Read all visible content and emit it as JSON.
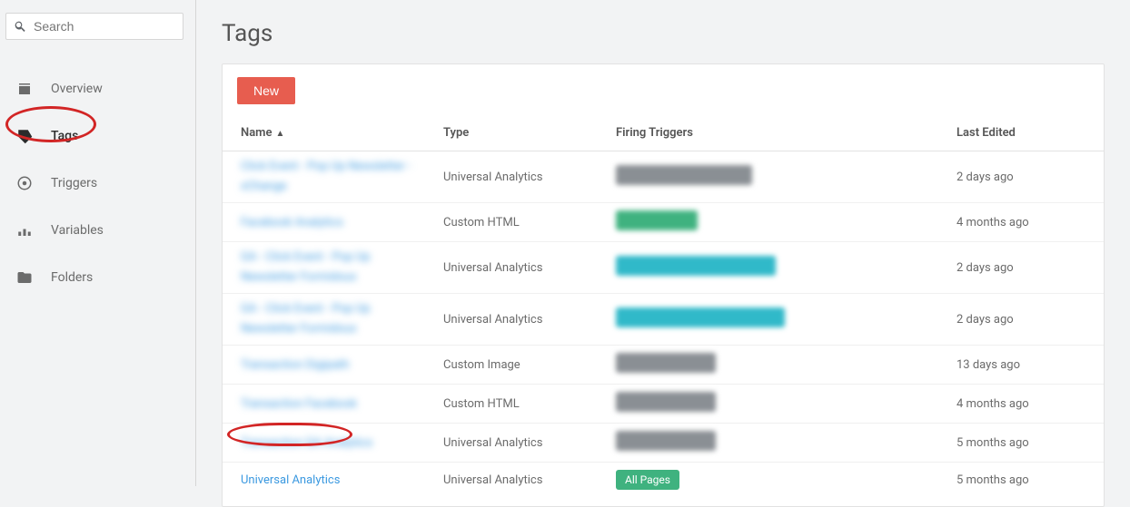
{
  "search": {
    "placeholder": "Search"
  },
  "sidebar": {
    "items": [
      {
        "label": "Overview",
        "icon": "overview"
      },
      {
        "label": "Tags",
        "icon": "tag"
      },
      {
        "label": "Triggers",
        "icon": "trigger"
      },
      {
        "label": "Variables",
        "icon": "variable"
      },
      {
        "label": "Folders",
        "icon": "folder"
      }
    ]
  },
  "page": {
    "title": "Tags",
    "new_label": "New"
  },
  "table": {
    "headers": {
      "name": "Name",
      "type": "Type",
      "triggers": "Firing Triggers",
      "edited": "Last Edited"
    },
    "rows": [
      {
        "name_blur": "Click Event - Pop Up Newsletter - xChange",
        "type": "Universal Analytics",
        "trigger_style": "gray",
        "trigger_w": 150,
        "edited": "2 days ago",
        "tall": true
      },
      {
        "name_blur": "Facebook Analytics",
        "type": "Custom HTML",
        "trigger_style": "green",
        "trigger_w": 90,
        "edited": "4 months ago",
        "tall": false
      },
      {
        "name_blur": "GA - Click Event - Pop Up Newsletter Formidoux",
        "type": "Universal Analytics",
        "trigger_style": "teal",
        "trigger_w": 176,
        "edited": "2 days ago",
        "tall": true
      },
      {
        "name_blur": "GA - Click Event - Pop Up Newsletter Formidoux",
        "type": "Universal Analytics",
        "trigger_style": "teal",
        "trigger_w": 186,
        "edited": "2 days ago",
        "tall": true
      },
      {
        "name_blur": "Transaction Digipath",
        "type": "Custom Image",
        "trigger_style": "gray",
        "trigger_w": 110,
        "edited": "13 days ago",
        "tall": false
      },
      {
        "name_blur": "Transaction Facebook",
        "type": "Custom HTML",
        "trigger_style": "gray",
        "trigger_w": 110,
        "edited": "4 months ago",
        "tall": false
      },
      {
        "name_blur": "Transaction GA Analytics",
        "type": "Universal Analytics",
        "trigger_style": "gray",
        "trigger_w": 110,
        "edited": "5 months ago",
        "tall": false
      },
      {
        "name_clear": "Universal Analytics",
        "type": "Universal Analytics",
        "trigger_clear": "All Pages",
        "edited": "5 months ago",
        "tall": false
      }
    ]
  }
}
